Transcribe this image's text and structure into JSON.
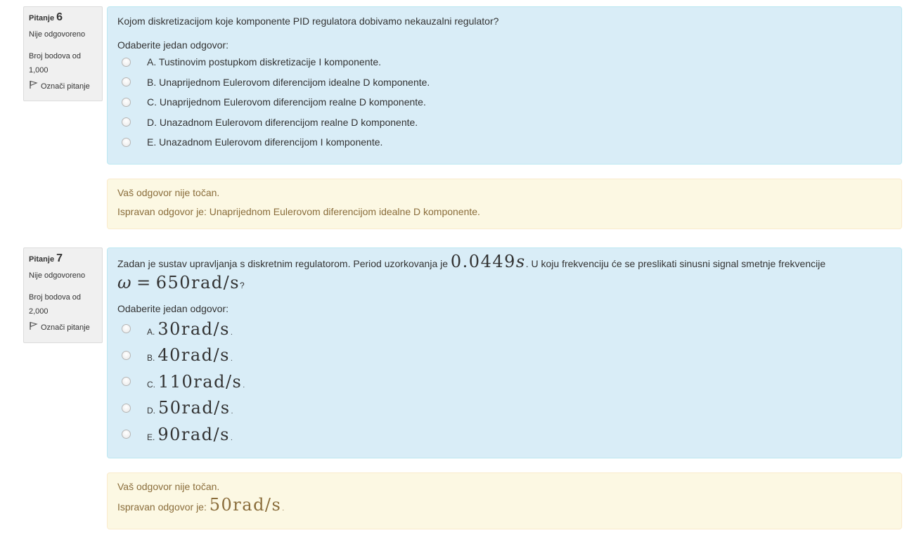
{
  "questions": [
    {
      "label": "Pitanje",
      "number": "6",
      "state": "Nije odgovoreno",
      "grade": "Broj bodova od 1,000",
      "flag": "Označi pitanje",
      "text": "Kojom diskretizacijom koje komponente PID regulatora dobivamo nekauzalni regulator?",
      "prompt": "Odaberite jedan odgovor:",
      "options": [
        "A. Tustinovim postupkom diskretizacije I komponente.",
        "B. Unaprijednom Eulerovom diferencijom idealne D komponente.",
        "C. Unaprijednom Eulerovom diferencijom realne D komponente.",
        "D. Unazadnom Eulerovom diferencijom realne D komponente.",
        "E. Unazadnom Eulerovom diferencijom I komponente."
      ],
      "feedback": "Vaš odgovor nije točan.",
      "right_answer": "Ispravan odgovor je: Unaprijednom Eulerovom diferencijom idealne D komponente."
    },
    {
      "label": "Pitanje",
      "number": "7",
      "state": "Nije odgovoreno",
      "grade": "Broj bodova od 2,000",
      "flag": "Označi pitanje",
      "text_before": "Zadan je sustav upravljanja s diskretnim regulatorom. Period uzorkovanja je",
      "period_value": "0.0449",
      "period_unit": "s",
      "text_middle": ". U koju frekvenciju će se preslikati sinusni signal smetnje frekvencije",
      "omega_symbol": "ω",
      "omega_equals": "=",
      "omega_value": "650rad/s",
      "text_end": "?",
      "prompt": "Odaberite jedan odgovor:",
      "options": [
        {
          "letter": "A.",
          "value": "30rad/s",
          "end": "."
        },
        {
          "letter": "B.",
          "value": "40rad/s",
          "end": "."
        },
        {
          "letter": "C.",
          "value": "110rad/s",
          "end": "."
        },
        {
          "letter": "D.",
          "value": "50rad/s",
          "end": "."
        },
        {
          "letter": "E.",
          "value": "90rad/s",
          "end": "."
        }
      ],
      "feedback": "Vaš odgovor nije točan.",
      "right_answer_label": "Ispravan odgovor je:",
      "right_answer_value": "50rad/s",
      "right_answer_end": "."
    }
  ]
}
